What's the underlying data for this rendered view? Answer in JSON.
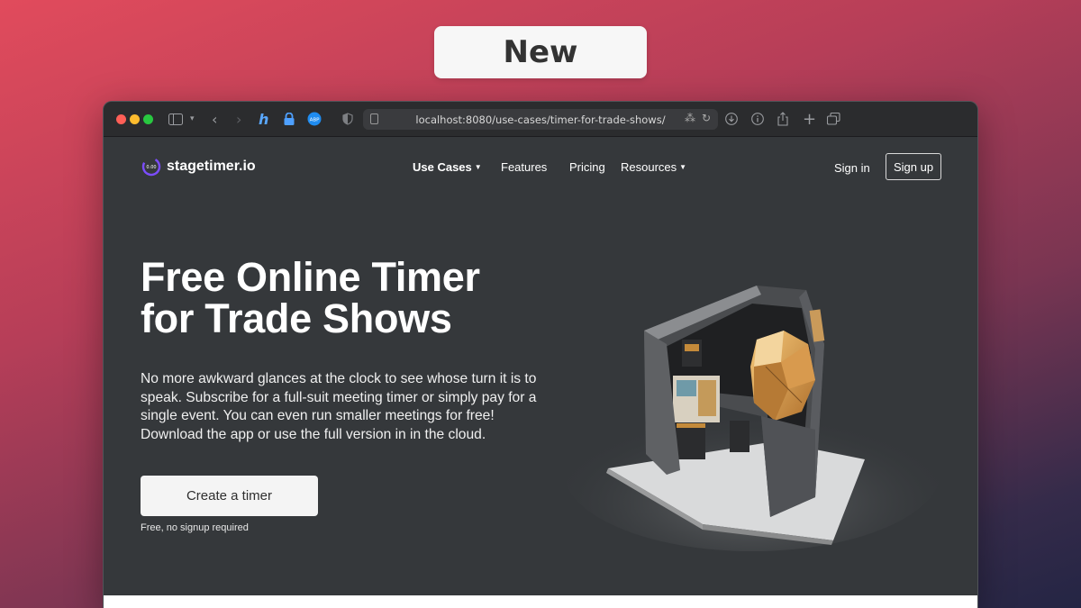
{
  "badge": {
    "label": "New"
  },
  "browser": {
    "url": "localhost:8080/use-cases/timer-for-trade-shows/",
    "extension_badge": "ABP"
  },
  "site": {
    "logo": {
      "text": "stagetimer.io",
      "mark_text": "0.00"
    },
    "nav": {
      "use_cases": "Use Cases",
      "features": "Features",
      "pricing": "Pricing",
      "resources": "Resources"
    },
    "signin": "Sign in",
    "signup": "Sign up",
    "hero": {
      "title_line1": "Free Online Timer",
      "title_line2": "for Trade Shows",
      "description": "No more awkward glances at the clock to see whose turn it is to speak. Subscribe for a full-suit meeting timer or simply pay for a single event. You can even run smaller meetings for free! Download the app or use the full version in in the cloud.",
      "cta": "Create a timer",
      "cta_note": "Free, no signup required"
    }
  },
  "colors": {
    "accent_purple": "#7c4dff",
    "site_background": "#35383b",
    "toolbar": "#2b2c2e"
  }
}
